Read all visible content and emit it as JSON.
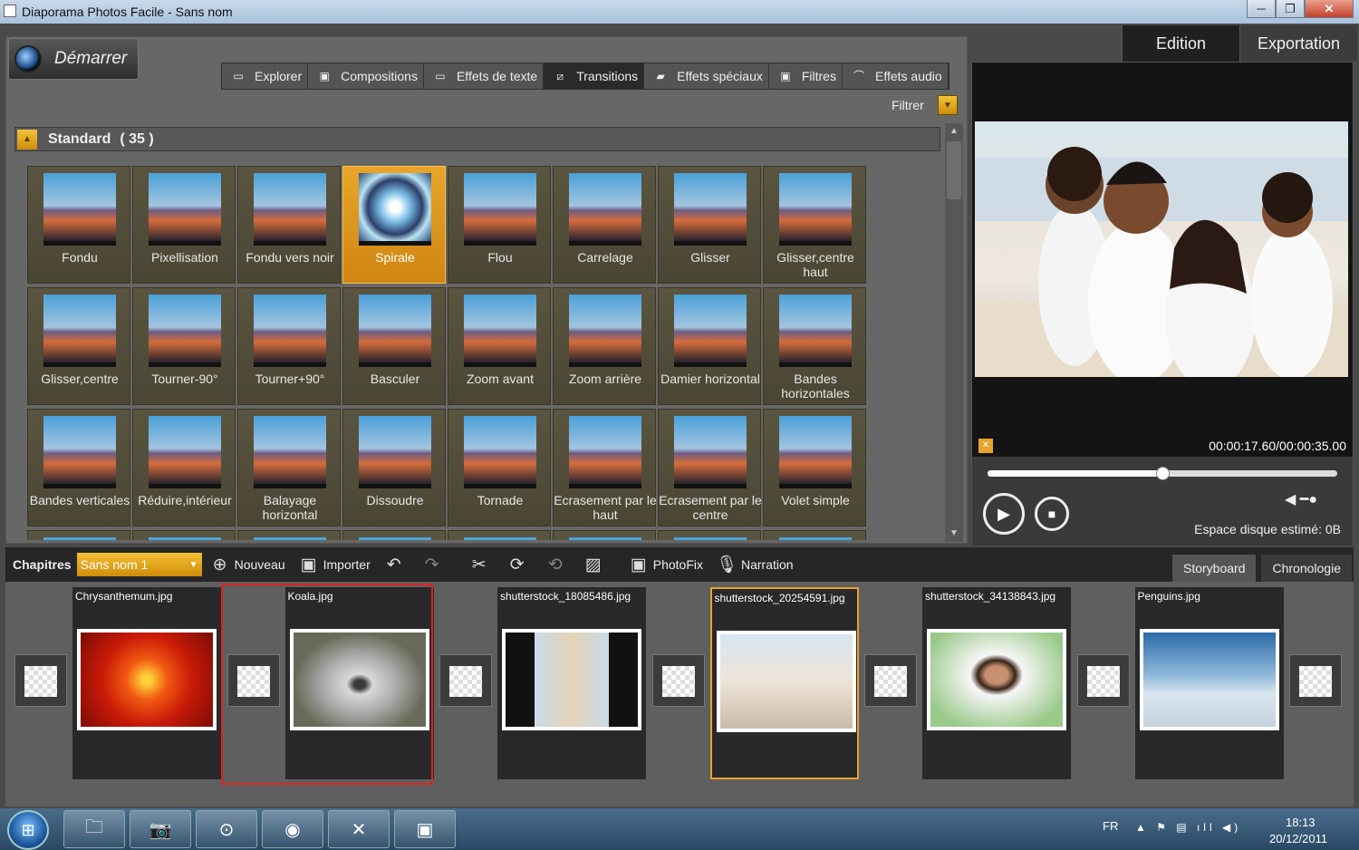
{
  "window": {
    "title": "Diaporama Photos Facile - Sans nom",
    "min": "─",
    "max": "❐",
    "close": "✕"
  },
  "start_button": {
    "label": "Démarrer"
  },
  "top_tabs": [
    {
      "label": "Edition",
      "active": true
    },
    {
      "label": "Exportation",
      "active": false
    }
  ],
  "category_tabs": [
    {
      "label": "Explorer",
      "icon": "folder-icon",
      "glyph": "▭"
    },
    {
      "label": "Compositions",
      "icon": "compositions-icon",
      "glyph": "▣"
    },
    {
      "label": "Effets de texte",
      "icon": "text-effects-icon",
      "glyph": "▭"
    },
    {
      "label": "Transitions",
      "icon": "transitions-icon",
      "glyph": "⧄",
      "active": true
    },
    {
      "label": "Effets spéciaux",
      "icon": "clapper-icon",
      "glyph": "▰"
    },
    {
      "label": "Filtres",
      "icon": "filters-icon",
      "glyph": "▣"
    },
    {
      "label": "Effets audio",
      "icon": "headphones-icon",
      "glyph": "⌒"
    }
  ],
  "filter": {
    "label": "Filtrer",
    "icon": "▼"
  },
  "group": {
    "name": "Standard",
    "count": "( 35 )",
    "icon": "▲"
  },
  "transitions": [
    {
      "label": "Fondu"
    },
    {
      "label": "Pixellisation"
    },
    {
      "label": "Fondu vers noir"
    },
    {
      "label": "Spirale",
      "selected": true
    },
    {
      "label": "Flou"
    },
    {
      "label": "Carrelage"
    },
    {
      "label": "Glisser"
    },
    {
      "label": "Glisser,centre haut"
    },
    {
      "label": "Glisser,centre"
    },
    {
      "label": "Tourner-90°"
    },
    {
      "label": "Tourner+90°"
    },
    {
      "label": "Basculer"
    },
    {
      "label": "Zoom avant"
    },
    {
      "label": "Zoom arrière"
    },
    {
      "label": "Damier horizontal"
    },
    {
      "label": "Bandes horizontales"
    },
    {
      "label": "Bandes verticales"
    },
    {
      "label": "Réduire,intérieur"
    },
    {
      "label": "Balayage horizontal"
    },
    {
      "label": "Dissoudre"
    },
    {
      "label": "Tornade"
    },
    {
      "label": "Ecrasement par le haut"
    },
    {
      "label": "Ecrasement par le centre"
    },
    {
      "label": "Volet simple"
    },
    {
      "label": ""
    },
    {
      "label": ""
    },
    {
      "label": ""
    },
    {
      "label": ""
    },
    {
      "label": ""
    },
    {
      "label": ""
    },
    {
      "label": ""
    },
    {
      "label": ""
    }
  ],
  "preview": {
    "timecode": "00:00:17.60/00:00:35.00",
    "progress": 0.5,
    "disk": "Espace disque estimé: 0B",
    "play": "▶",
    "stop": "■",
    "volume": "◀ ━●"
  },
  "toolbar": {
    "chapters_label": "Chapitres",
    "chapter_value": "Sans nom 1",
    "chapter_arrow": "▼",
    "new_label": "Nouveau",
    "import_label": "Importer",
    "photofix_label": "PhotoFix",
    "narration_label": "Narration",
    "icons": {
      "new": "⊕",
      "import": "▣",
      "undo": "↶",
      "redo": "↷",
      "cut": "✂",
      "rotate1": "⟳",
      "rotate2": "⟲",
      "crop": "▨",
      "photofix": "▣",
      "narration": "🎙"
    }
  },
  "view_tabs": [
    {
      "label": "Storyboard",
      "active": true
    },
    {
      "label": "Chronologie",
      "active": false
    }
  ],
  "slides": [
    {
      "name": "Chrysanthemum.jpg"
    },
    {
      "name": "Koala.jpg"
    },
    {
      "name": "shutterstock_18085486.jpg"
    },
    {
      "name": "shutterstock_20254591.jpg"
    },
    {
      "name": "shutterstock_34138843.jpg"
    },
    {
      "name": "Penguins.jpg"
    }
  ],
  "taskbar": {
    "start": "⊞",
    "apps": [
      "🗀",
      "📷",
      "⊙",
      "◉",
      "✕",
      "▣"
    ],
    "lang": "FR",
    "time": "18:13",
    "date": "20/12/2011",
    "tray_icons": "▲ ⚑ ▤ ıll ◀)"
  }
}
